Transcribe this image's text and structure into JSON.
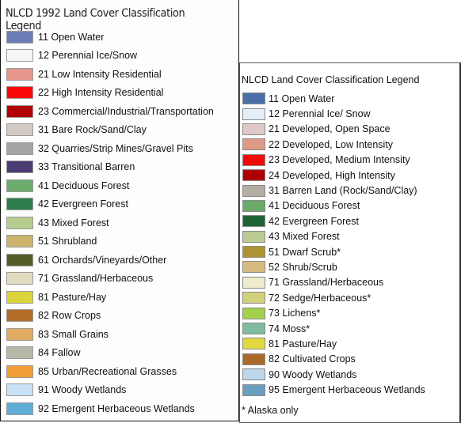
{
  "legend_1992": {
    "title": "NLCD 1992 Land Cover Classification Legend",
    "items": [
      {
        "label": "11 Open Water",
        "color": "#6a7db4"
      },
      {
        "label": "12 Perennial Ice/Snow",
        "color": "#f5f5f5"
      },
      {
        "label": "21 Low Intensity Residential",
        "color": "#e4978a"
      },
      {
        "label": "22 High Intensity Residential",
        "color": "#fb0707"
      },
      {
        "label": "23 Commercial/Industrial/Transportation",
        "color": "#b10104"
      },
      {
        "label": "31 Bare Rock/Sand/Clay",
        "color": "#d2c9c2"
      },
      {
        "label": "32 Quarries/Strip Mines/Gravel Pits",
        "color": "#a5a5a5"
      },
      {
        "label": "33 Transitional Barren",
        "color": "#4c3c74"
      },
      {
        "label": "41 Deciduous Forest",
        "color": "#6cac6c"
      },
      {
        "label": "42 Evergreen Forest",
        "color": "#2d7f4c"
      },
      {
        "label": "43 Mixed Forest",
        "color": "#b6cd8f"
      },
      {
        "label": "51 Shrubland",
        "color": "#cdb46d"
      },
      {
        "label": "61 Orchards/Vineyards/Other",
        "color": "#545c2a"
      },
      {
        "label": "71 Grassland/Herbaceous",
        "color": "#e1dcc0"
      },
      {
        "label": "81 Pasture/Hay",
        "color": "#dcd43c"
      },
      {
        "label": "82 Row Crops",
        "color": "#b16d26"
      },
      {
        "label": "83 Small Grains",
        "color": "#e1ab62"
      },
      {
        "label": "84 Fallow",
        "color": "#b7b7a8"
      },
      {
        "label": "85 Urban/Recreational Grasses",
        "color": "#f29e37"
      },
      {
        "label": "91 Woody Wetlands",
        "color": "#c8e1f4"
      },
      {
        "label": "92 Emergent Herbaceous Wetlands",
        "color": "#5fadd6"
      }
    ]
  },
  "legend_current": {
    "title": "NLCD Land Cover Classification Legend",
    "items": [
      {
        "label": "11 Open Water",
        "color": "#4a6ea8"
      },
      {
        "label": "12 Perennial Ice/ Snow",
        "color": "#e6eefa"
      },
      {
        "label": "21 Developed, Open Space",
        "color": "#e0c8c8"
      },
      {
        "label": "22 Developed, Low Intensity",
        "color": "#de9a85"
      },
      {
        "label": "23 Developed, Medium Intensity",
        "color": "#f50a0a"
      },
      {
        "label": "24 Developed, High Intensity",
        "color": "#ae0003"
      },
      {
        "label": "31 Barren Land (Rock/Sand/Clay)",
        "color": "#b3ada3"
      },
      {
        "label": "41 Deciduous Forest",
        "color": "#6aa967"
      },
      {
        "label": "42 Evergreen Forest",
        "color": "#1e6433"
      },
      {
        "label": "43 Mixed Forest",
        "color": "#bccb93"
      },
      {
        "label": "51 Dwarf Scrub*",
        "color": "#ae9332"
      },
      {
        "label": "52 Shrub/Scrub",
        "color": "#d6ba80"
      },
      {
        "label": "71 Grassland/Herbaceous",
        "color": "#efecce"
      },
      {
        "label": "72 Sedge/Herbaceous*",
        "color": "#d3d07c"
      },
      {
        "label": "73 Lichens*",
        "color": "#a3d14d"
      },
      {
        "label": "74 Moss*",
        "color": "#7fbc9f"
      },
      {
        "label": "81 Pasture/Hay",
        "color": "#e0d83e"
      },
      {
        "label": "82 Cultivated Crops",
        "color": "#ac6a2a"
      },
      {
        "label": "90 Woody Wetlands",
        "color": "#bcd6ec"
      },
      {
        "label": "95 Emergent Herbaceous Wetlands",
        "color": "#6b9fc0"
      }
    ],
    "footnote": "* Alaska only"
  }
}
